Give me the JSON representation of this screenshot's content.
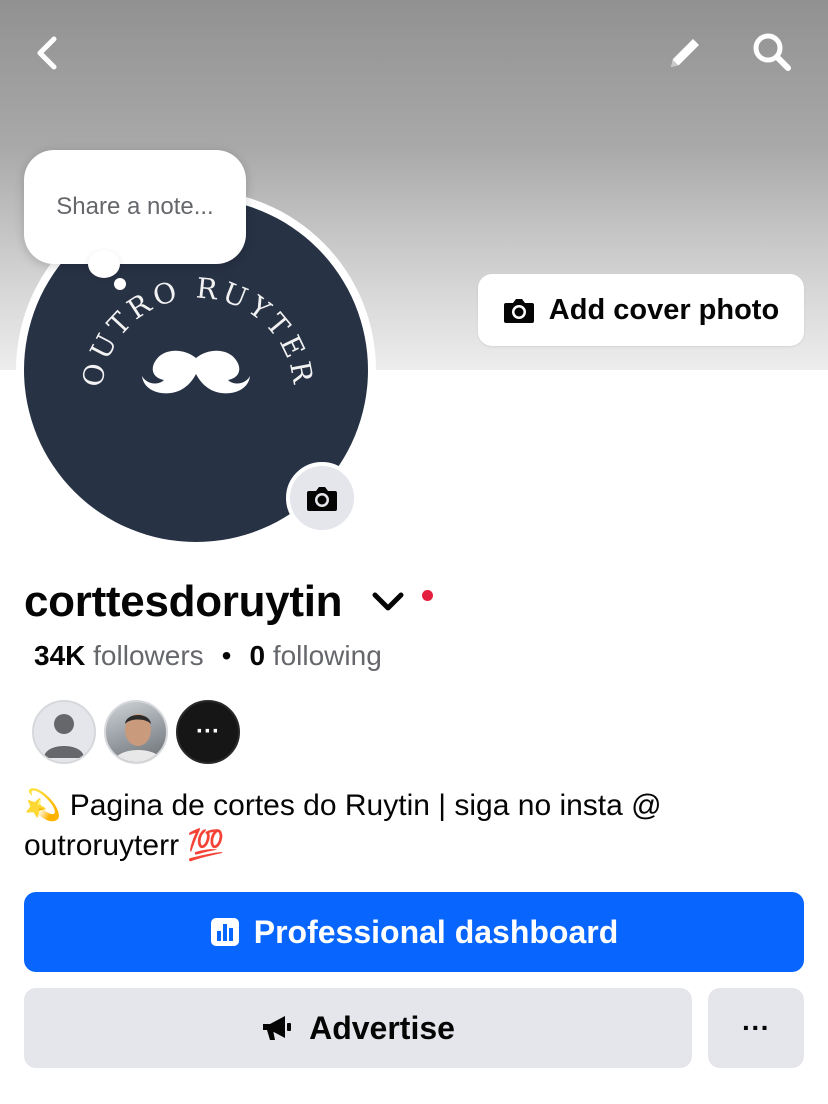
{
  "header": {
    "back_icon": "chevron-left-icon",
    "edit_icon": "pencil-icon",
    "search_icon": "search-icon"
  },
  "cover": {
    "add_cover_label": "Add cover photo"
  },
  "note": {
    "placeholder": "Share a note..."
  },
  "avatar": {
    "logo_text": "OUTRO RUYTER"
  },
  "profile": {
    "name": "corttesdoruytin",
    "followers_count": "34K",
    "followers_label": "followers",
    "separator": "•",
    "following_count": "0",
    "following_label": "following",
    "bio_emoji_start": "💫",
    "bio_text": "Pagina de cortes do Ruytin | siga no insta @ outroruyterr",
    "bio_emoji_end": "💯"
  },
  "friends": {
    "more_label": "···"
  },
  "actions": {
    "primary_label": "Professional dashboard",
    "advertise_label": "Advertise",
    "more_label": "···"
  },
  "colors": {
    "accent": "#0866ff",
    "secondary_button": "#e4e6eb",
    "avatar_bg": "#273245",
    "status_dot": "#e41e3f"
  }
}
